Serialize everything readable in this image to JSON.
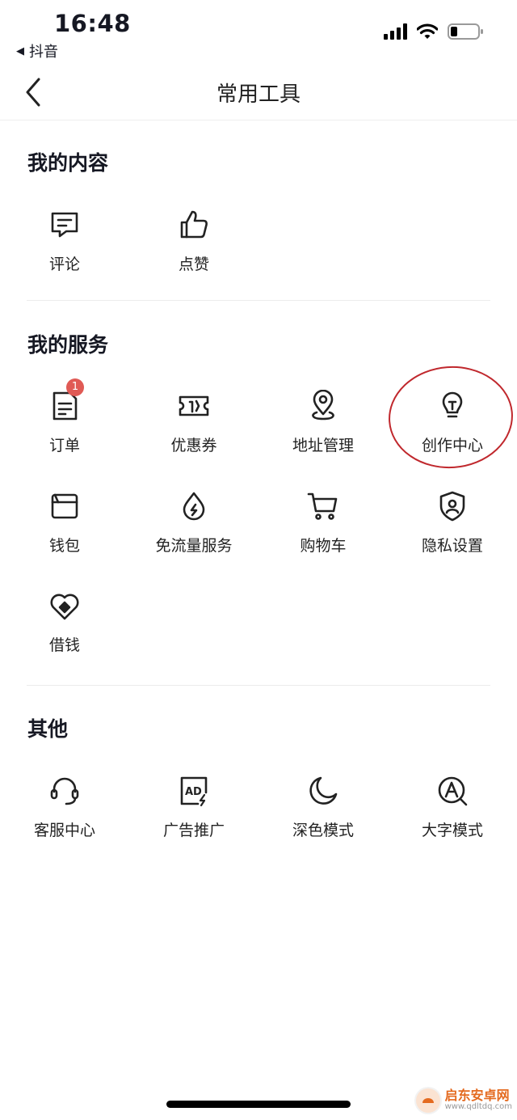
{
  "status_bar": {
    "time": "16:48",
    "back_app": "抖音"
  },
  "header": {
    "title": "常用工具"
  },
  "sections": [
    {
      "title": "我的内容",
      "items": [
        {
          "label": "评论",
          "icon": "comment-icon"
        },
        {
          "label": "点赞",
          "icon": "thumbs-up-icon"
        }
      ]
    },
    {
      "title": "我的服务",
      "items": [
        {
          "label": "订单",
          "icon": "order-icon",
          "badge": "1"
        },
        {
          "label": "优惠券",
          "icon": "coupon-icon"
        },
        {
          "label": "地址管理",
          "icon": "location-pin-icon"
        },
        {
          "label": "创作中心",
          "icon": "lightbulb-icon",
          "highlighted": true
        },
        {
          "label": "钱包",
          "icon": "wallet-icon"
        },
        {
          "label": "免流量服务",
          "icon": "data-drop-icon"
        },
        {
          "label": "购物车",
          "icon": "cart-icon"
        },
        {
          "label": "隐私设置",
          "icon": "privacy-shield-icon"
        },
        {
          "label": "借钱",
          "icon": "loan-icon"
        }
      ]
    },
    {
      "title": "其他",
      "items": [
        {
          "label": "客服中心",
          "icon": "headset-icon"
        },
        {
          "label": "广告推广",
          "icon": "ad-icon"
        },
        {
          "label": "深色模式",
          "icon": "moon-icon"
        },
        {
          "label": "大字模式",
          "icon": "large-font-icon"
        }
      ]
    }
  ],
  "watermark": {
    "name": "启东安卓网",
    "url": "www.qdltdq.com"
  },
  "colors": {
    "text": "#161823",
    "badge": "#e05a55",
    "annotation": "#c0282d",
    "divider": "#ececec"
  }
}
